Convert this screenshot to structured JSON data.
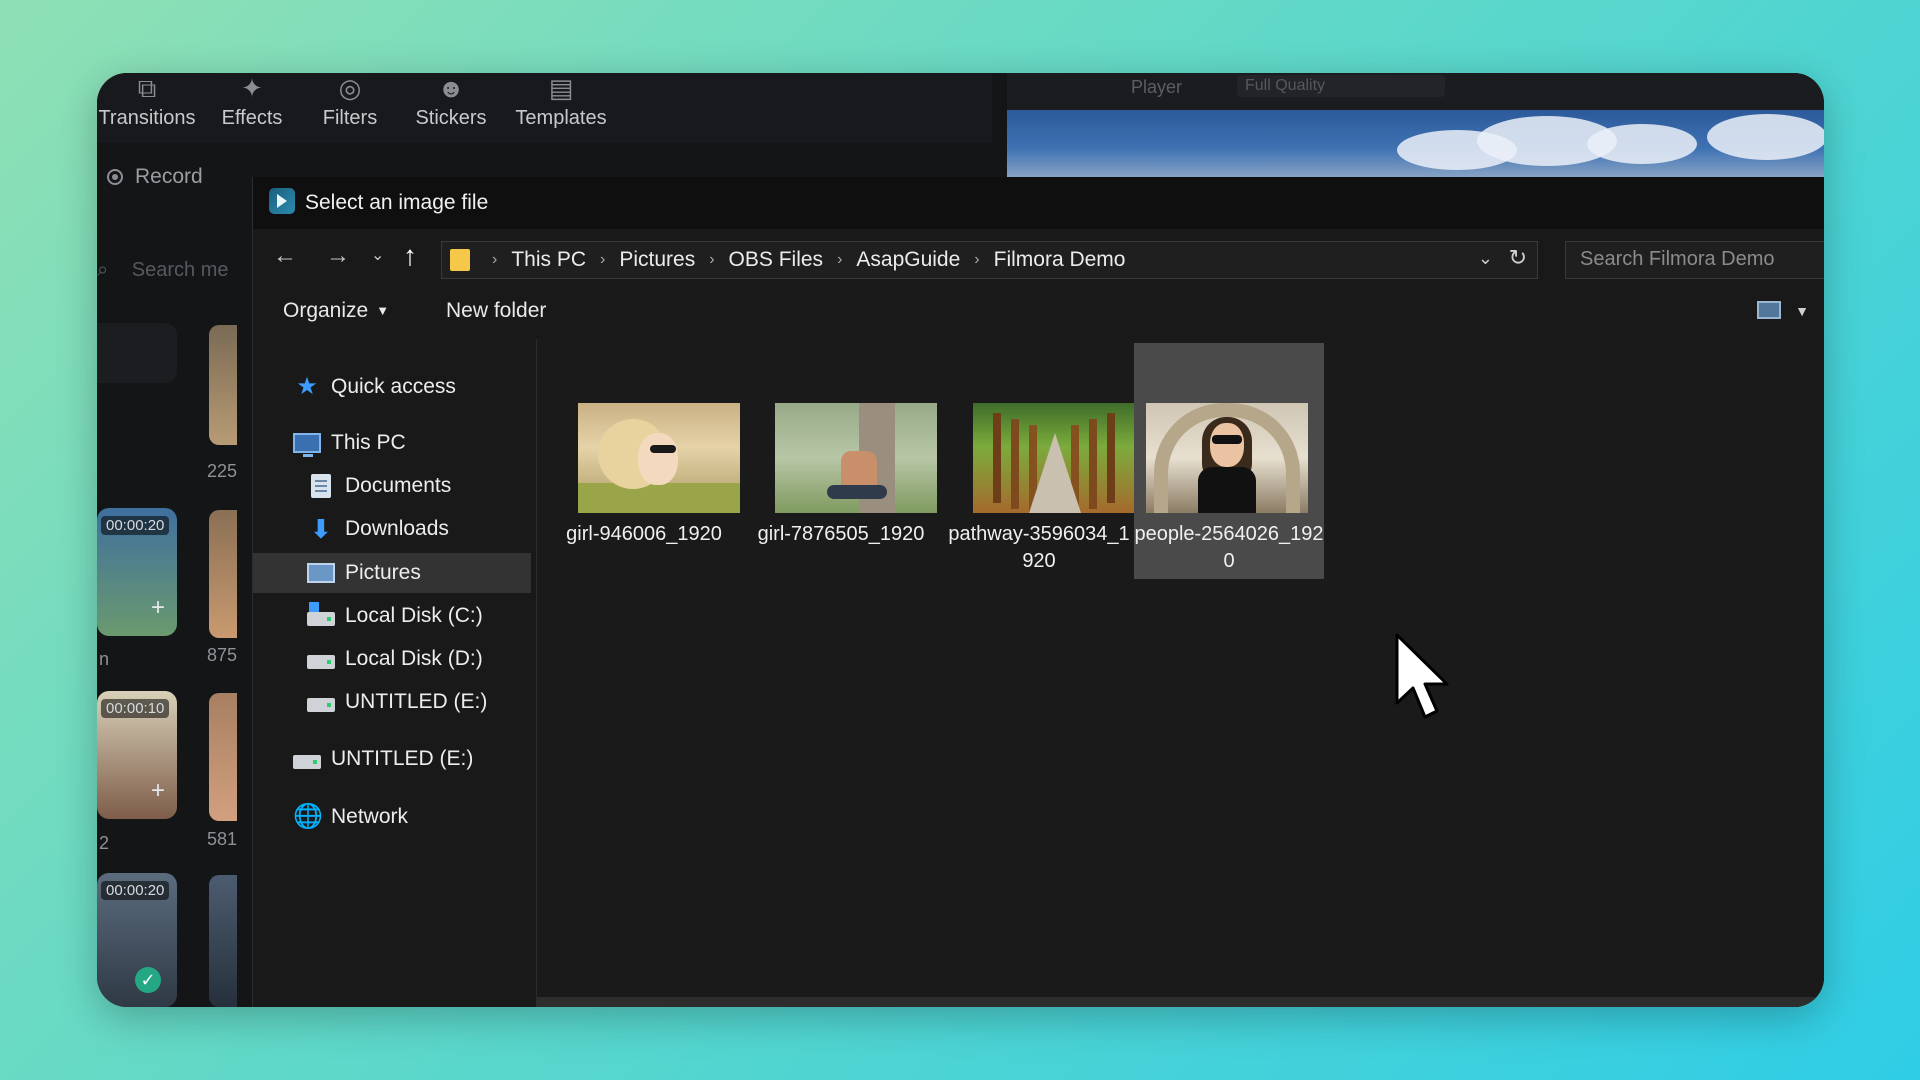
{
  "app": {
    "tabs": [
      {
        "label": "Transitions",
        "icon": "transitions-icon"
      },
      {
        "label": "Effects",
        "icon": "effects-icon"
      },
      {
        "label": "Filters",
        "icon": "filters-icon"
      },
      {
        "label": "Stickers",
        "icon": "stickers-icon"
      },
      {
        "label": "Templates",
        "icon": "templates-icon"
      }
    ],
    "record_label": "Record",
    "search_placeholder": "Search me",
    "media": [
      {
        "time": "00:00:20",
        "num": "225"
      },
      {
        "time": "00:00:10",
        "num": "875"
      },
      {
        "time": "00:00:20",
        "num": "581"
      }
    ],
    "media_labels": [
      "n",
      "2"
    ],
    "preview_label": "Player",
    "preview_quality": "Full Quality"
  },
  "dialog": {
    "title": "Select an image file",
    "breadcrumb": [
      "This PC",
      "Pictures",
      "OBS Files",
      "AsapGuide",
      "Filmora Demo"
    ],
    "search_placeholder": "Search Filmora Demo",
    "organize_label": "Organize",
    "new_folder_label": "New folder",
    "nav": [
      {
        "label": "Quick access",
        "icon": "star-icon"
      },
      {
        "label": "This PC",
        "icon": "computer-icon"
      },
      {
        "label": "Documents",
        "icon": "documents-icon"
      },
      {
        "label": "Downloads",
        "icon": "downloads-icon"
      },
      {
        "label": "Pictures",
        "icon": "pictures-icon",
        "selected": true
      },
      {
        "label": "Local Disk (C:)",
        "icon": "drive-icon"
      },
      {
        "label": "Local Disk (D:)",
        "icon": "drive-icon"
      },
      {
        "label": "UNTITLED (E:)",
        "icon": "drive-icon"
      },
      {
        "label": "UNTITLED (E:)",
        "icon": "drive-icon"
      },
      {
        "label": "Network",
        "icon": "network-icon"
      }
    ],
    "files": [
      {
        "name": "girl-946006_1920"
      },
      {
        "name": "girl-7876505_1920"
      },
      {
        "name": "pathway-3596034_1920"
      },
      {
        "name": "people-2564026_1920",
        "selected": true
      }
    ]
  },
  "colors": {
    "background_gradient": [
      "#8fe0b4",
      "#2fcde6"
    ],
    "dialog_bg": "#191919",
    "selection": "#4a4a4a",
    "folder_yellow": "#f5c84a",
    "accent_blue": "#3e9bff"
  }
}
